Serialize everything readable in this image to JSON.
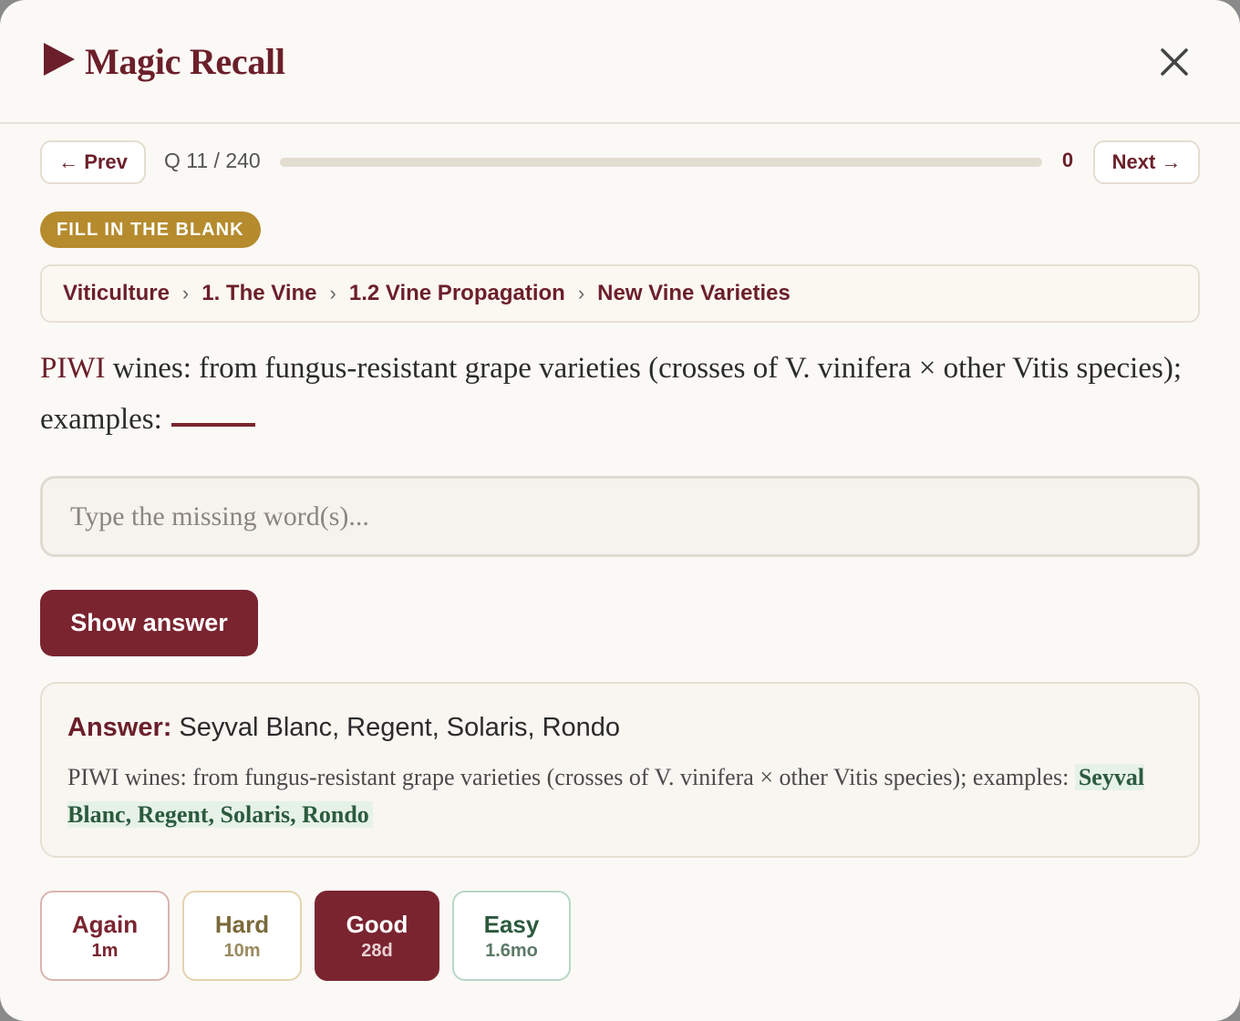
{
  "app": {
    "title": "Magic Recall"
  },
  "nav": {
    "prev_label": "← Prev",
    "next_label": "Next →",
    "question_counter": "Q 11 / 240",
    "progress": 0,
    "score": "0"
  },
  "card": {
    "type_badge": "FILL IN THE BLANK",
    "breadcrumb": [
      "Viticulture",
      "1. The Vine",
      "1.2 Vine Propagation",
      "New Vine Varieties"
    ],
    "question_term": "PIWI",
    "question_text": " wines: from fungus-resistant grape varieties (crosses of V. vinifera × other Vitis species); examples:"
  },
  "input": {
    "placeholder": "Type the missing word(s)..."
  },
  "show_answer_label": "Show answer",
  "answer": {
    "label": "Answer:",
    "value": "Seyval Blanc, Regent, Solaris, Rondo",
    "context": "PIWI wines: from fungus-resistant grape varieties (crosses of V. vinifera × other Vitis species); examples: ",
    "context_answer": "Seyval Blanc, Regent, Solaris, Rondo"
  },
  "rating": [
    {
      "label": "Again",
      "interval": "1m"
    },
    {
      "label": "Hard",
      "interval": "10m"
    },
    {
      "label": "Good",
      "interval": "28d"
    },
    {
      "label": "Easy",
      "interval": "1.6mo"
    }
  ],
  "colors": {
    "brand": "#6b1f2a",
    "accent_button": "#7a2430",
    "badge": "#b58b2e",
    "answer_highlight_bg": "#e6f2e8",
    "answer_highlight_text": "#2c5a3e"
  },
  "icons": {
    "logo": "play-triangle-icon",
    "close": "close-icon"
  }
}
